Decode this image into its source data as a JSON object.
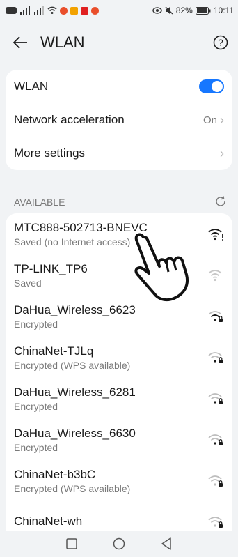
{
  "status_bar": {
    "left_icons": [
      "hd-icon",
      "signal-icon",
      "signal-icon",
      "wifi-icon",
      "app-icon",
      "app-icon",
      "app-icon",
      "app-icon"
    ],
    "battery": "82%",
    "time": "10:11"
  },
  "header": {
    "title": "WLAN"
  },
  "settings": [
    {
      "label": "WLAN",
      "type": "toggle",
      "value": "on"
    },
    {
      "label": "Network acceleration",
      "type": "value",
      "value": "On"
    },
    {
      "label": "More settings",
      "type": "chevron",
      "value": ""
    }
  ],
  "available": {
    "section_label": "AVAILABLE",
    "networks": [
      {
        "name": "MTC888-502713-BNEVC",
        "status": "Saved (no Internet access)",
        "signal": "full-warning"
      },
      {
        "name": "TP-LINK_TP6",
        "status": "Saved",
        "signal": "faint"
      },
      {
        "name": "DaHua_Wireless_6623",
        "status": "Encrypted",
        "signal": "lock"
      },
      {
        "name": "ChinaNet-TJLq",
        "status": "Encrypted (WPS available)",
        "signal": "lock"
      },
      {
        "name": "DaHua_Wireless_6281",
        "status": "Encrypted",
        "signal": "lock"
      },
      {
        "name": "DaHua_Wireless_6630",
        "status": "Encrypted",
        "signal": "lock"
      },
      {
        "name": "ChinaNet-b3bC",
        "status": "Encrypted (WPS available)",
        "signal": "lock"
      },
      {
        "name": "ChinaNet-wh",
        "status": "",
        "signal": "lock"
      }
    ]
  },
  "colors": {
    "accent": "#1677ff",
    "background": "#f1f3f5",
    "card": "#ffffff",
    "secondary_text": "#7a7a7a"
  }
}
